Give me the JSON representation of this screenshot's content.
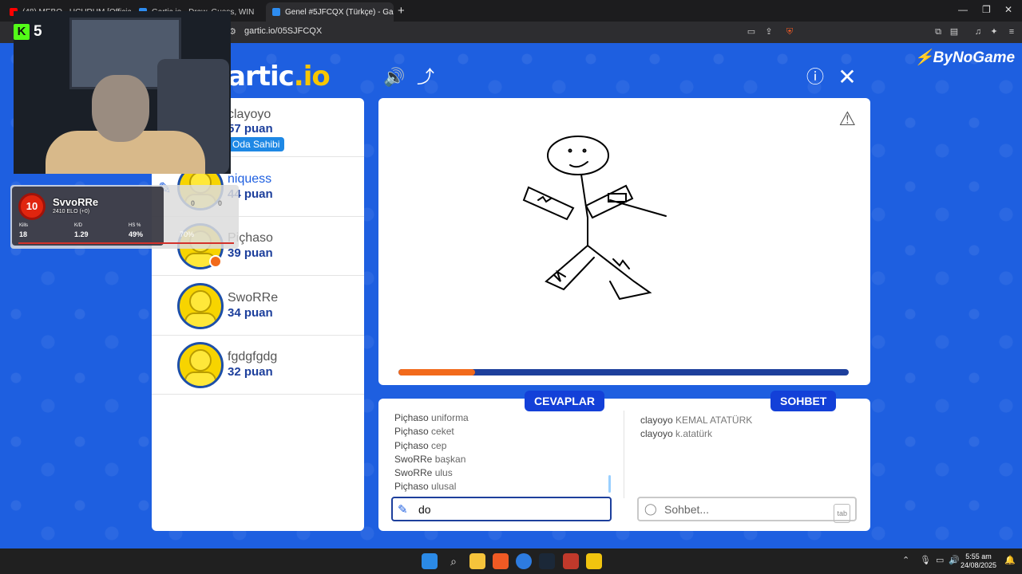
{
  "browser": {
    "tabs": [
      {
        "title": "(48) MEBO - UÇURUM [Official V...",
        "fav": "#ff0000"
      },
      {
        "title": "Gartic.io - Draw, Guess, WIN",
        "fav": "#2d8cf0"
      },
      {
        "title": "Genel #5JFCQX (Türkçe) - Gartic",
        "fav": "#2d8cf0"
      }
    ],
    "url": "gartic.io/05SJFCQX"
  },
  "stream": {
    "kick_icon": "K",
    "kick_count": "5"
  },
  "faceit": {
    "level": "10",
    "name": "SvvoRRe",
    "elo": "2410 ELO (+0)",
    "kills_label": "Kills",
    "kills": "18",
    "kd_label": "K/D",
    "kd": "1.29",
    "hs_label": "HS %",
    "hs": "49%",
    "win": "70%",
    "mini_a": "0",
    "mini_b": "0"
  },
  "game": {
    "logo_main": "artic",
    "logo_io": ".io",
    "sponsor_main": "ByNoGame",
    "owner_badge": "Oda Sahibi",
    "players": [
      {
        "name": "clayoyo",
        "score": "57 puan"
      },
      {
        "name": "niquess",
        "score": "44 puan"
      },
      {
        "name": "Piçhaso",
        "score": "39 puan"
      },
      {
        "name": "SwoRRe",
        "score": "34 puan"
      },
      {
        "name": "fgdgfgdg",
        "score": "32 puan"
      }
    ],
    "progress": 0.17,
    "answers_label": "CEVAPLAR",
    "chat_label": "SOHBET",
    "answers": [
      {
        "user": "Piçhaso",
        "guess": "uniforma"
      },
      {
        "user": "Piçhaso",
        "guess": "ceket"
      },
      {
        "user": "Piçhaso",
        "guess": "cep"
      },
      {
        "user": "SwoRRe",
        "guess": "başkan"
      },
      {
        "user": "SwoRRe",
        "guess": "ulus"
      },
      {
        "user": "Piçhaso",
        "guess": "ulusal"
      }
    ],
    "chat": [
      {
        "user": "clayoyo",
        "msg": "KEMAL ATATÜRK"
      },
      {
        "user": "clayoyo",
        "msg": "k.atatürk"
      }
    ],
    "answer_input_value": "do",
    "chat_placeholder": "Sohbet...",
    "tab_key": "tab"
  },
  "taskbar": {
    "time": "5:55 am",
    "date": "24/08/2025"
  }
}
